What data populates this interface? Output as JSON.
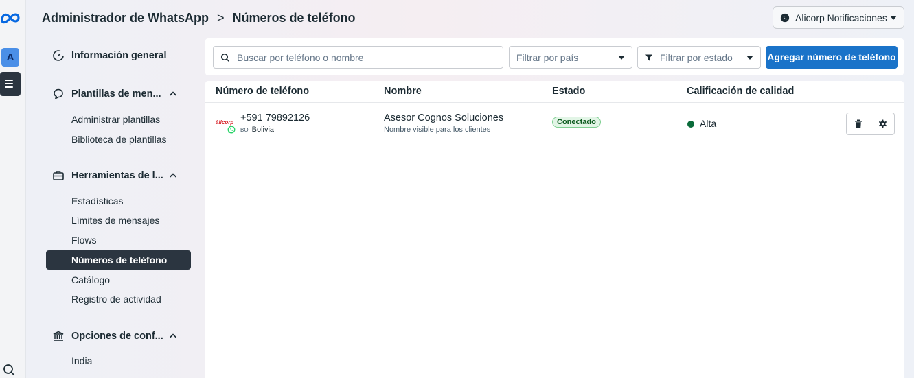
{
  "header": {
    "app_title": "Administrador de WhatsApp",
    "separator": ">",
    "page_title": "Números de teléfono",
    "account_name": "Alicorp Notificaciones"
  },
  "rail": {
    "avatar_letter": "A"
  },
  "sidebar": {
    "general": "Información general",
    "sections": [
      {
        "label": "Plantillas de men...",
        "items": [
          "Administrar plantillas",
          "Biblioteca de plantillas"
        ]
      },
      {
        "label": "Herramientas de l...",
        "items": [
          "Estadísticas",
          "Límites de mensajes",
          "Flows",
          "Números de teléfono",
          "Catálogo",
          "Registro de actividad"
        ]
      },
      {
        "label": "Opciones de conf...",
        "items": [
          "India"
        ]
      }
    ],
    "active_item": "Números de teléfono"
  },
  "filters": {
    "search_placeholder": "Buscar por teléfono o nombre",
    "country_placeholder": "Filtrar por país",
    "status_placeholder": "Filtrar por estado",
    "add_button": "Agregar número de teléfono"
  },
  "table": {
    "columns": [
      "Número de teléfono",
      "Nombre",
      "Estado",
      "Calificación de calidad"
    ],
    "rows": [
      {
        "brand": "âlicorp",
        "phone": "+591 79892126",
        "country_code": "BO",
        "country": "Bolivia",
        "name": "Asesor Cognos Soluciones",
        "name_sub": "Nombre visible para los clientes",
        "status": "Conectado",
        "quality": "Alta",
        "quality_color": "#0a6b3a"
      }
    ]
  },
  "colors": {
    "primary": "#1a73c9",
    "dark": "#2b3540",
    "status_green": "#0c5a1e"
  }
}
